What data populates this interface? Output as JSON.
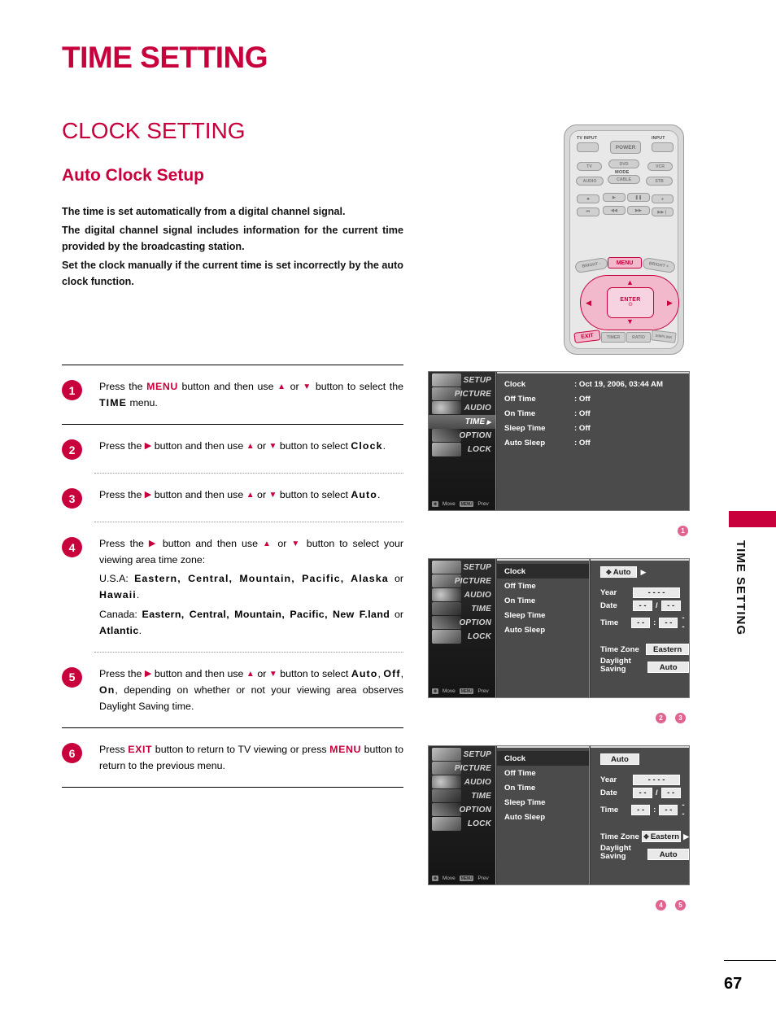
{
  "page": {
    "title": "TIME SETTING",
    "section": "CLOCK SETTING",
    "subsection": "Auto Clock Setup",
    "edge_tab_label": "TIME SETTING",
    "page_number": "67"
  },
  "intro": {
    "line1": "The time is set automatically from a digital channel signal.",
    "line2": "The digital channel signal includes information for the current time provided by the broadcasting station.",
    "line3": "Set the clock manually if the current time is set incorrectly by the auto clock function."
  },
  "steps": [
    {
      "number": "1",
      "pre": "Press the ",
      "key1": "MENU",
      "mid1": " button and then use ",
      "up": "▲",
      "or": " or ",
      "down": "▼",
      "mid2": " button to select the ",
      "key2": "TIME",
      "post": " menu."
    },
    {
      "number": "2",
      "pre": "Press the ",
      "right": "▶",
      "mid1": " button and then use ",
      "up": "▲",
      "or": " or ",
      "down": "▼",
      "mid2": " button to select ",
      "key2": "Clock",
      "post": "."
    },
    {
      "number": "3",
      "pre": "Press the ",
      "right": "▶",
      "mid1": " button and then use ",
      "up": "▲",
      "or": " or ",
      "down": "▼",
      "mid2": " button to select ",
      "key2": "Auto",
      "post": "."
    },
    {
      "number": "4",
      "pre": "Press the ",
      "right": "▶",
      "mid1": " button and then use ",
      "up": "▲",
      "or": " or ",
      "down": "▼",
      "mid2": " button to select your viewing area time zone:",
      "usa_label": "U.S.A:",
      "usa_zones": "Eastern, Central, Mountain, Pacific, Alaska",
      "usa_or": " or ",
      "usa_last": "Hawaii",
      "usa_end": ".",
      "canada_label": "Canada:",
      "canada_zones": "Eastern, Central, Mountain, Pacific, New F.land",
      "canada_or": " or ",
      "canada_last": "Atlantic",
      "canada_end": "."
    },
    {
      "number": "5",
      "pre": "Press the ",
      "right": "▶",
      "mid1": " button and then use ",
      "up": "▲",
      "or": " or ",
      "down": "▼",
      "mid2": " button to select ",
      "opt1": "Auto",
      "comma1": ", ",
      "opt2": "Off",
      "comma2": ", ",
      "opt3": "On",
      "post": ", depending on whether or not your viewing area observes Daylight Saving time."
    },
    {
      "number": "6",
      "pre": "Press ",
      "key1": "EXIT",
      "mid1": " button to return to TV viewing or press ",
      "key2": "MENU",
      "post": " button to return to the previous menu."
    }
  ],
  "remote": {
    "tv_input_label": "TV INPUT",
    "input_label": "INPUT",
    "power_label": "POWER",
    "mode_label": "MODE",
    "mode_buttons_top": [
      "TV",
      "DVD",
      "VCR"
    ],
    "mode_buttons_bottom": [
      "AUDIO",
      "CABLE",
      "STB"
    ],
    "transport_top": [
      "■",
      "▶",
      "❙❙",
      "●"
    ],
    "transport_bottom": [
      "⏮",
      "◀◀",
      "▶▶",
      "⏭"
    ],
    "bright_minus": "BRIGHT -",
    "menu_label": "MENU",
    "bright_plus": "BRIGHT +",
    "enter_label": "ENTER",
    "enter_dot": "⊙",
    "dpad_up": "▲",
    "dpad_down": "▼",
    "dpad_left": "◀",
    "dpad_right": "▶",
    "bottom_row": [
      "EXIT",
      "TIMER",
      "RATIO",
      "SIMPLINK"
    ]
  },
  "tv_menu": {
    "side_items": [
      "SETUP",
      "PICTURE",
      "AUDIO",
      "TIME",
      "OPTION",
      "LOCK"
    ],
    "nav_move": "Move",
    "nav_move_chip": "✥",
    "nav_prev": "Prev",
    "nav_prev_chip": "MENU",
    "list_items": [
      "Clock",
      "Off Time",
      "On Time",
      "Sleep Time",
      "Auto Sleep"
    ]
  },
  "shot1": {
    "marks": [
      "1"
    ],
    "selected_side": "TIME",
    "rows": [
      {
        "label": "Clock",
        "value": ": Oct 19, 2006, 03:44 AM"
      },
      {
        "label": "Off Time",
        "value": ": Off"
      },
      {
        "label": "On Time",
        "value": ": Off"
      },
      {
        "label": "Sleep Time",
        "value": ": Off"
      },
      {
        "label": "Auto Sleep",
        "value": ": Off"
      }
    ]
  },
  "shot2": {
    "marks": [
      "2",
      "3"
    ],
    "selected_list_item": "Clock",
    "mode_value": "Auto",
    "mode_pin": "✥",
    "mode_arrow": "▶",
    "year_label": "Year",
    "year_value": "- - - -",
    "date_label": "Date",
    "date_month": "- -",
    "date_sep": "/",
    "date_day": "- -",
    "time_label": "Time",
    "time_hour": "- -",
    "time_sep": ":",
    "time_min": "- -",
    "time_ampm": "- -",
    "timezone_label": "Time Zone",
    "timezone_value": "Eastern",
    "dst_label_1": "Daylight",
    "dst_label_2": "Saving",
    "dst_value": "Auto"
  },
  "shot3": {
    "marks": [
      "4",
      "5"
    ],
    "selected_list_item": "Clock",
    "mode_value": "Auto",
    "year_label": "Year",
    "year_value": "- - - -",
    "date_label": "Date",
    "date_month": "- -",
    "date_sep": "/",
    "date_day": "- -",
    "time_label": "Time",
    "time_hour": "- -",
    "time_sep": ":",
    "time_min": "- -",
    "time_ampm": "- -",
    "timezone_label": "Time Zone",
    "timezone_value": "Eastern",
    "timezone_pin": "✥",
    "timezone_arrow": "▶",
    "dst_label_1": "Daylight",
    "dst_label_2": "Saving",
    "dst_value": "Auto"
  },
  "colors": {
    "accent": "#c8003c",
    "accent_light": "#f2b9cc",
    "marker": "#e06490"
  }
}
